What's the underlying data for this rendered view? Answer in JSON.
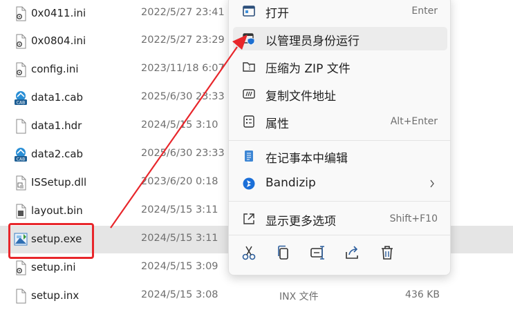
{
  "files": [
    {
      "name": "0x0411.ini",
      "date": "2022/5/27 23:41",
      "type": "",
      "size": "",
      "icon": "settings-file-icon"
    },
    {
      "name": "0x0804.ini",
      "date": "2022/5/27 23:29",
      "type": "",
      "size": "",
      "icon": "settings-file-icon"
    },
    {
      "name": "config.ini",
      "date": "2023/11/18 6:07",
      "type": "",
      "size": "",
      "icon": "settings-file-icon"
    },
    {
      "name": "data1.cab",
      "date": "2025/6/30 23:33",
      "type": "",
      "size": "",
      "icon": "cab-file-icon"
    },
    {
      "name": "data1.hdr",
      "date": "2024/5/15 3:10",
      "type": "",
      "size": "",
      "icon": "blank-file-icon"
    },
    {
      "name": "data2.cab",
      "date": "2025/6/30 23:33",
      "type": "",
      "size": "",
      "icon": "cab-file-icon"
    },
    {
      "name": "ISSetup.dll",
      "date": "2023/6/20 0:18",
      "type": "",
      "size": "",
      "icon": "dll-file-icon"
    },
    {
      "name": "layout.bin",
      "date": "2024/5/15 3:11",
      "type": "",
      "size": "",
      "icon": "bin-file-icon"
    },
    {
      "name": "setup.exe",
      "date": "2024/5/15 3:11",
      "type": "",
      "size": "",
      "icon": "setup-exe-icon"
    },
    {
      "name": "setup.ini",
      "date": "2024/5/15 3:09",
      "type": "",
      "size": "",
      "icon": "settings-file-icon"
    },
    {
      "name": "setup.inx",
      "date": "2024/5/15 3:08",
      "type": "INX 文件",
      "size": "436 KB",
      "icon": "settings-file-icon"
    }
  ],
  "context_menu": {
    "items": [
      {
        "label": "打开",
        "shortcut": "Enter",
        "icon": "open-app-icon"
      },
      {
        "label": "以管理员身份运行",
        "shortcut": "",
        "icon": "shield-admin-icon"
      },
      {
        "label": "压缩为 ZIP 文件",
        "shortcut": "",
        "icon": "zip-folder-icon"
      },
      {
        "label": "复制文件地址",
        "shortcut": "",
        "icon": "copy-path-icon"
      },
      {
        "label": "属性",
        "shortcut": "Alt+Enter",
        "icon": "properties-icon"
      },
      {
        "label": "在记事本中编辑",
        "shortcut": "",
        "icon": "notepad-icon"
      },
      {
        "label": "Bandizip",
        "shortcut": "",
        "icon": "bandizip-icon"
      },
      {
        "label": "显示更多选项",
        "shortcut": "Shift+F10",
        "icon": "more-options-icon"
      }
    ],
    "actions": [
      "cut-icon",
      "copy-icon",
      "rename-icon",
      "share-icon",
      "delete-icon"
    ]
  },
  "colors": {
    "highlight": "#e8262b",
    "accent": "#0067c0",
    "selected_row": "#e5e5e5"
  }
}
